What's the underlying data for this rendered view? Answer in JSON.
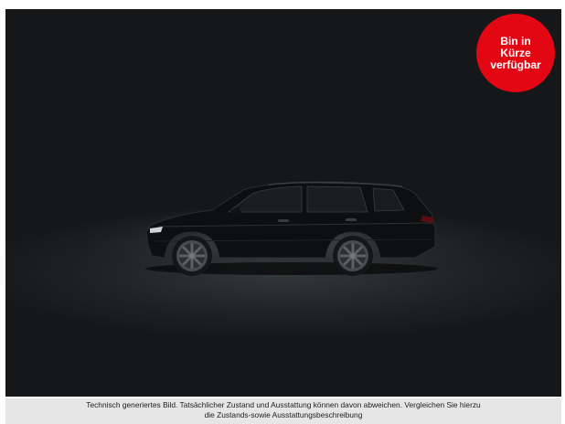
{
  "badge": {
    "line1": "Bin in",
    "line2": "Kürze",
    "line3": "verfügbar",
    "color": "#e30613"
  },
  "vehicle_image": {
    "icon": "car-side-view-icon"
  },
  "disclaimer": {
    "line1": "Technisch generiertes Bild. Tatsächlicher Zustand und Ausstattung können davon abweichen. Vergleichen Sie hierzu",
    "line2": "die Zustands-sowie Ausstattungsbeschreibung"
  }
}
